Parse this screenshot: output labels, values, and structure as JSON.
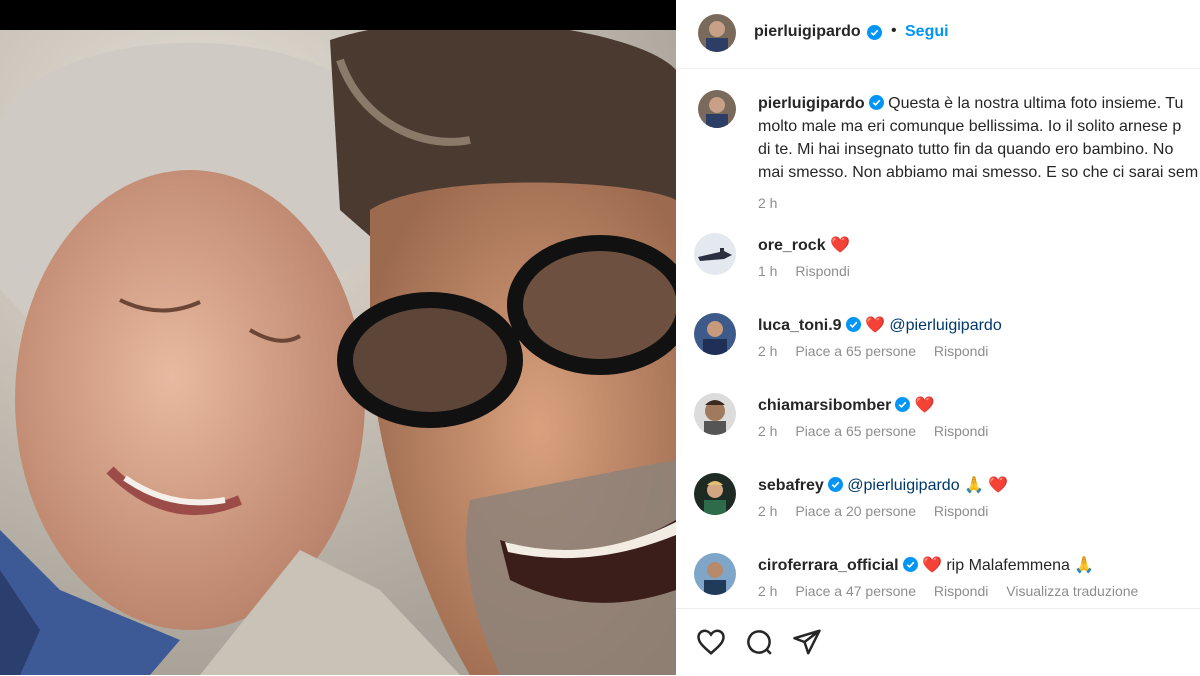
{
  "post": {
    "username": "pierluigipardo",
    "follow_label": "Segui",
    "separator": "•"
  },
  "caption": {
    "username": "pierluigipardo",
    "lines": [
      "Questa è la nostra ultima foto insieme. Tu",
      "molto male ma eri comunque bellissima. Io il solito arnese p",
      "di te. Mi hai insegnato tutto fin da quando ero bambino. No",
      "mai smesso. Non abbiamo mai smesso. E so che ci sarai sem"
    ],
    "time": "2 h"
  },
  "comments": [
    {
      "username": "ore_rock",
      "verified": false,
      "mention": "",
      "text": "",
      "emoji": "❤️",
      "time": "1 h",
      "likes": "",
      "reply": "Rispondi",
      "extra": ""
    },
    {
      "username": "luca_toni.9",
      "verified": true,
      "mention": "@pierluigipardo",
      "text": "",
      "emoji": "❤️",
      "time": "2 h",
      "likes": "Piace a 65 persone",
      "reply": "Rispondi",
      "extra": ""
    },
    {
      "username": "chiamarsibomber",
      "verified": true,
      "mention": "",
      "text": "",
      "emoji": "❤️",
      "time": "2 h",
      "likes": "Piace a 65 persone",
      "reply": "Rispondi",
      "extra": ""
    },
    {
      "username": "sebafrey",
      "verified": true,
      "mention": "@pierluigipardo",
      "text": "",
      "emoji": "🙏 ❤️",
      "time": "2 h",
      "likes": "Piace a 20 persone",
      "reply": "Rispondi",
      "extra": ""
    },
    {
      "username": "ciroferrara_official",
      "verified": true,
      "mention": "",
      "text": "rip Malafemmena",
      "emoji": "❤️",
      "time": "2 h",
      "likes": "Piace a 47 persone",
      "reply": "Rispondi",
      "extra": "Visualizza traduzione"
    }
  ],
  "colors": {
    "accent": "#0095f6",
    "verified": "#0095f6",
    "heart": "#ed4956",
    "muted": "#8e8e8e"
  },
  "icons": [
    "heart-icon",
    "comment-icon",
    "share-icon",
    "verified-badge-icon"
  ]
}
